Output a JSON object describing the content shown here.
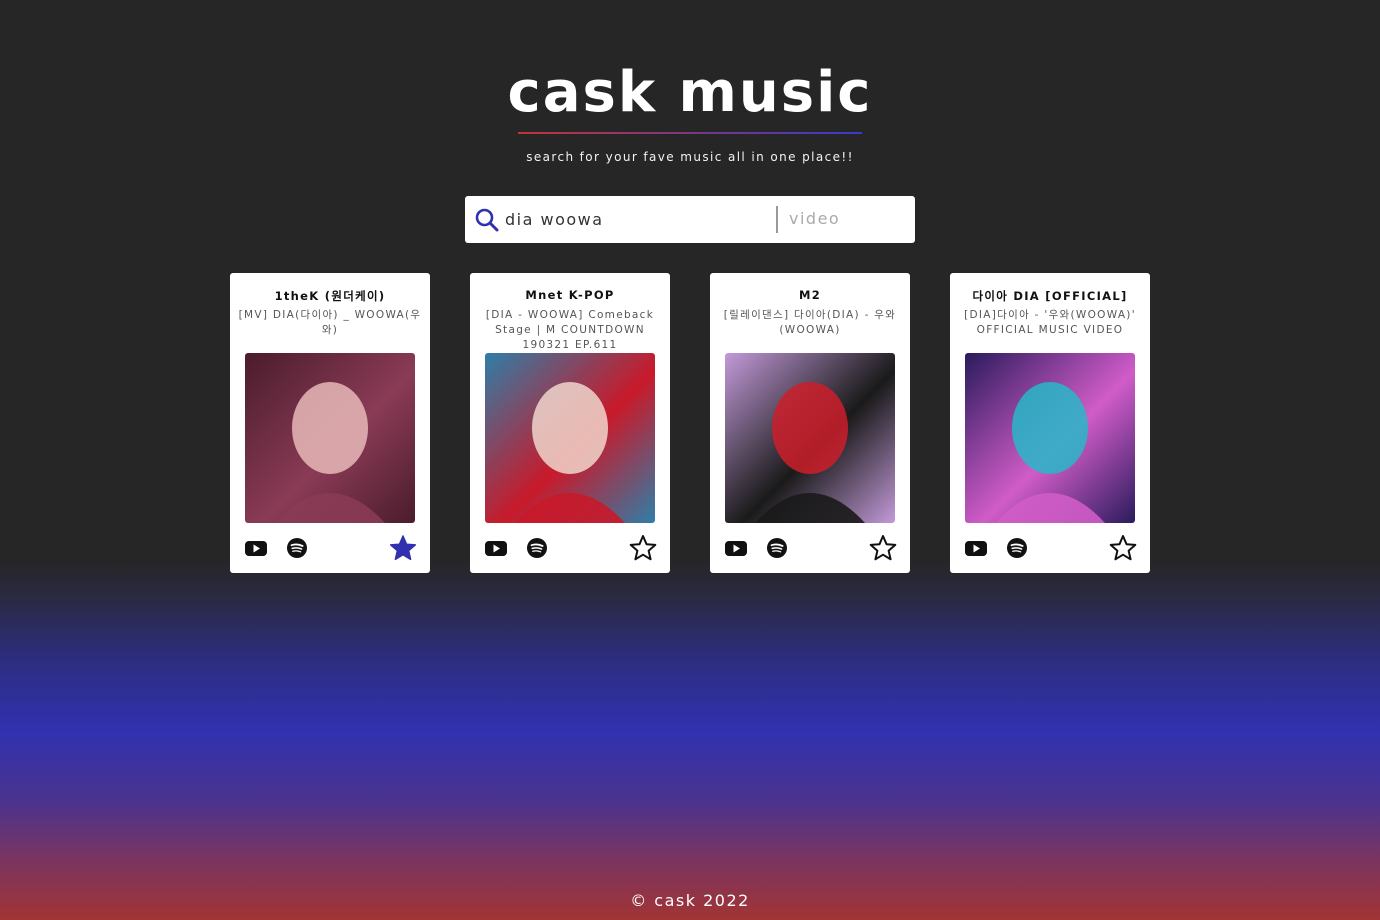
{
  "header": {
    "title": "cask music",
    "subtitle": "search for your fave music all in one place!!"
  },
  "search": {
    "query": "dia woowa",
    "type_selected": "video"
  },
  "results": [
    {
      "channel": "1theK (원더케이)",
      "title": "[MV] DIA(다이아) _ WOOWA(우와)",
      "favorited": true,
      "thumb_colors": [
        "#4a1c2c",
        "#8a3b55",
        "#e8b9b8"
      ]
    },
    {
      "channel": "Mnet K-POP",
      "title": "[DIA - WOOWA] Comeback Stage | M COUNTDOWN 190321 EP.611",
      "favorited": false,
      "thumb_colors": [
        "#2f7ea8",
        "#c81a2a",
        "#f0d6cc"
      ]
    },
    {
      "channel": "M2",
      "title": "[릴레이댄스] 다이아(DIA) - 우와(WOOWA)",
      "favorited": false,
      "thumb_colors": [
        "#c29ad8",
        "#1a1a1a",
        "#cc1f2a"
      ]
    },
    {
      "channel": "다이아 DIA [OFFICIAL]",
      "title": "[DIA]다이아 - '우와(WOOWA)' OFFICIAL MUSIC VIDEO",
      "favorited": false,
      "thumb_colors": [
        "#2a1b5c",
        "#d05cc8",
        "#27b8c8"
      ]
    }
  ],
  "footer": {
    "copyright": "© cask 2022"
  },
  "colors": {
    "accent": "#3030b0",
    "background": "#262626",
    "gradient_red": "#a23434"
  }
}
